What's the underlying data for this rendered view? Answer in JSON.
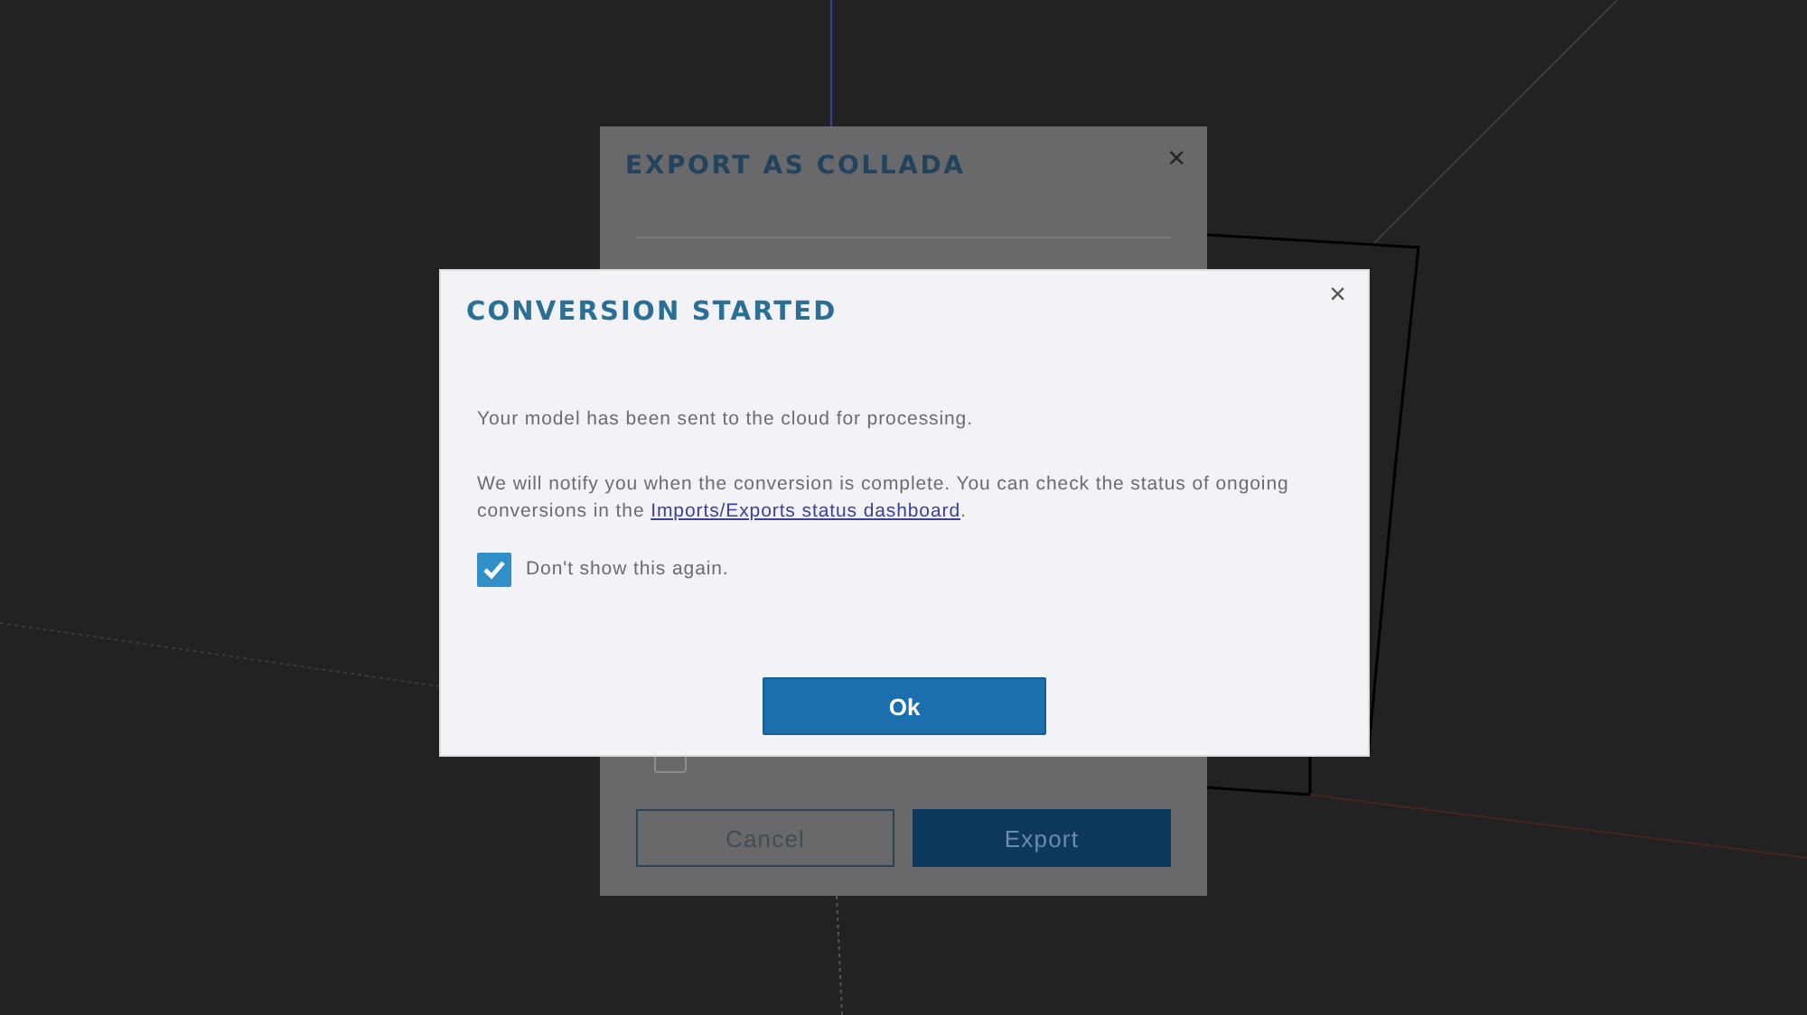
{
  "background_dialog": {
    "title": "EXPORT AS COLLADA",
    "close": "×",
    "checkbox": {
      "checked": false
    },
    "buttons": [
      {
        "label": "Cancel",
        "kind": "secondary"
      },
      {
        "label": "Export",
        "kind": "primary"
      }
    ]
  },
  "dialog": {
    "title": "CONVERSION STARTED",
    "close": "×",
    "message": "Your model has been sent to the cloud for processing.",
    "notice": {
      "text_before": "We will notify you when the conversion is complete. You can check the status of ongoing conversions in the ",
      "link": "Imports/Exports status dashboard",
      "text_after": "."
    },
    "checkbox": {
      "label": "Don't show this again.",
      "checked": true
    },
    "buttons": [
      {
        "label": "Ok",
        "kind": "primary"
      }
    ]
  }
}
